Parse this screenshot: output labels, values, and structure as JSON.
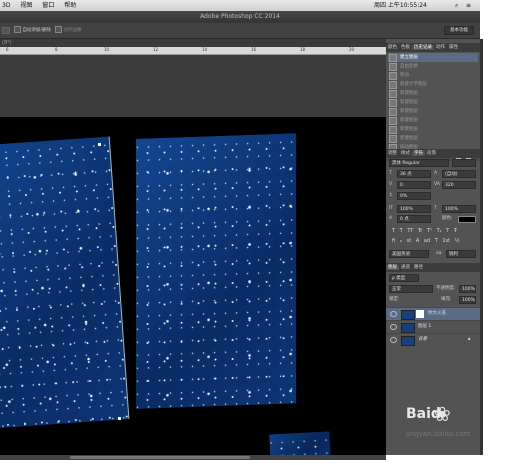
{
  "menubar": {
    "items": [
      "3D",
      "视图",
      "窗口",
      "帮助"
    ],
    "datetime": "周四 上午10:55:24"
  },
  "titlebar": {
    "title": "Adobe Photoshop CC 2014"
  },
  "options": {
    "auto_add_delete": "自动添加/删除",
    "align_edges": "对齐边缘",
    "workspace": "基本功能"
  },
  "doc_tab": "(8*)",
  "ruler_ticks": [
    "6",
    "8",
    "10",
    "12",
    "14",
    "16",
    "18",
    "20",
    "22"
  ],
  "panel_tabs": [
    "颜色",
    "色板",
    "历史记录",
    "动作",
    "属性"
  ],
  "history": {
    "items": [
      "建立图层",
      "自由变换",
      "移动",
      "新建文字图层",
      "新建图层",
      "新建图层",
      "新建图层",
      "新建图层",
      "新建图层",
      "新建图层",
      "描边图层"
    ]
  },
  "char_tabs": [
    "调整",
    "样式",
    "字符",
    "段落"
  ],
  "character": {
    "font": "黑体 Regular",
    "size": "36 点",
    "leading": "(自动)",
    "kerning": "0",
    "tracking": "320",
    "vscale": "0%",
    "hscale_v": "100%",
    "hscale_h": "100%",
    "baseline": "0 点",
    "color_label": "颜色:",
    "glyphs": [
      "T",
      "T",
      "TT",
      "Tr",
      "T¹",
      "T₁",
      "T",
      "Ŧ"
    ],
    "glyphs2": [
      "fi",
      "ℴ",
      "st",
      "A",
      "ad",
      "T",
      "1st",
      "½"
    ],
    "language": "美国英语",
    "aa": "锐利"
  },
  "layers_tabs": [
    "图层",
    "通道",
    "路径"
  ],
  "layers": {
    "kind": "ρ 类型",
    "blend": "正常",
    "opacity_label": "不透明度:",
    "opacity": "100%",
    "lock_label": "锁定:",
    "fill_label": "填充:",
    "fill": "100%",
    "rows": [
      "你文火盖",
      "图层 1",
      "背景"
    ]
  },
  "watermark": {
    "brand": "Baid",
    "site": "jingyan.baidu.com"
  },
  "colors": {
    "canvas_blue": "#0b2f6e",
    "panel": "#535353",
    "selected": "#5a6b84"
  }
}
